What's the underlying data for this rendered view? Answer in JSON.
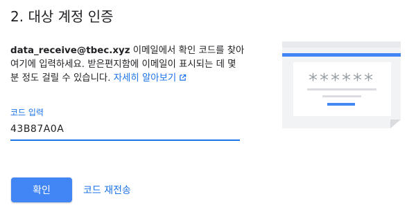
{
  "section": {
    "title": "2. 대상 계정 인증"
  },
  "description": {
    "email": "data_receive@tbec.xyz",
    "text": " 이메일에서 확인 코드를 찾아 여기에 입력하세요. 받은편지함에 이메일이 표시되는 데 몇 분 정도 걸릴 수 있습니다. ",
    "learn_more": "자세히 알아보기"
  },
  "code_input": {
    "label": "코드 입력",
    "value": "43B87A0A"
  },
  "actions": {
    "confirm_label": "확인",
    "resend_label": "코드 재전송"
  },
  "illustration": {
    "masked_code": "******"
  },
  "colors": {
    "accent": "#1a73e8",
    "button": "#4285f4",
    "illustration_fill": "#f1f3f4"
  },
  "icons": {
    "external_link": "open-in-new-icon"
  }
}
